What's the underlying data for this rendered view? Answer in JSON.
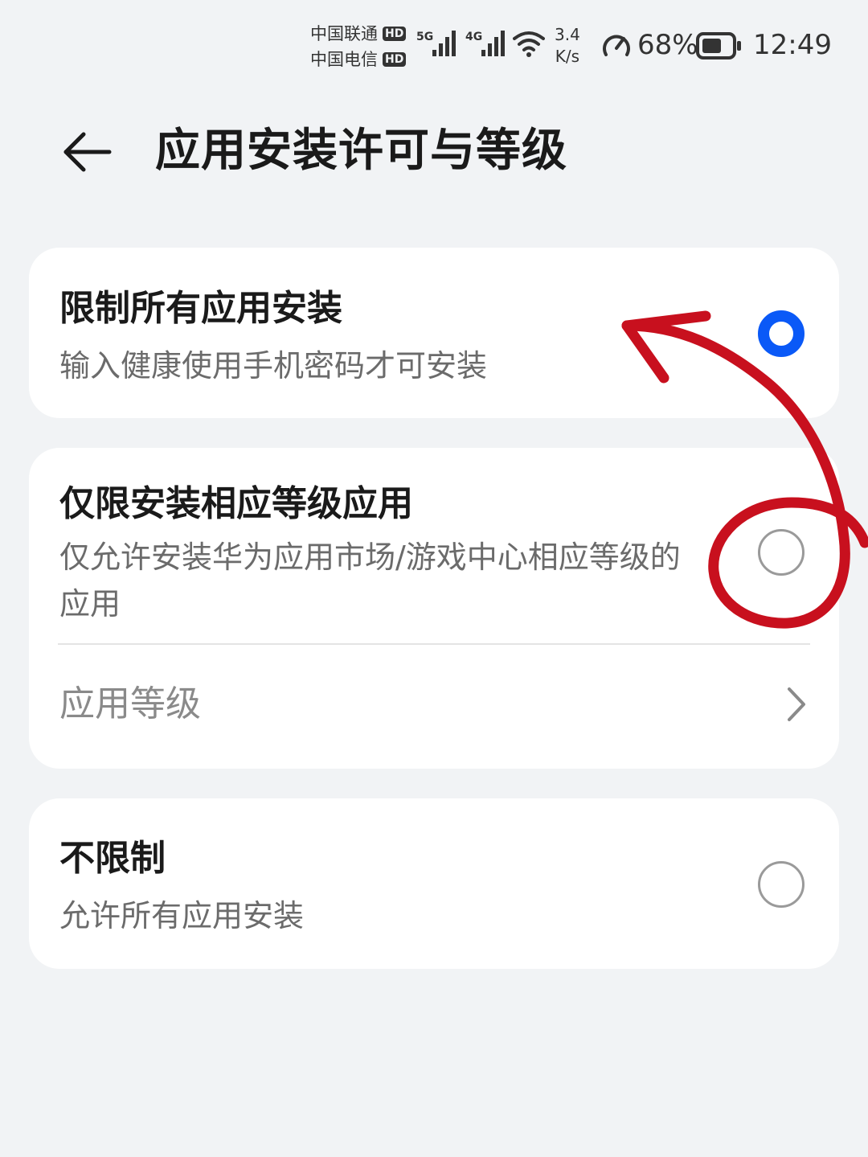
{
  "status_bar": {
    "carrier_1": "中国联通",
    "carrier_2": "中国电信",
    "hd_badge": "HD",
    "net_1": "5G",
    "net_2": "4G",
    "speed_value": "3.4",
    "speed_unit": "K/s",
    "battery_percent": "68%",
    "time": "12:49",
    "battery_level": 0.68,
    "icons": [
      "signal-5g-icon",
      "signal-4g-icon",
      "wifi-icon",
      "speed-gauge-icon",
      "battery-icon"
    ]
  },
  "header": {
    "title": "应用安装许可与等级",
    "back_icon": "back-arrow-icon"
  },
  "options": [
    {
      "title": "限制所有应用安装",
      "description": "输入健康使用手机密码才可安装",
      "selected": true
    },
    {
      "title": "仅限安装相应等级应用",
      "description": "仅允许安装华为应用市场/游戏中心相应等级的应用",
      "selected": false
    },
    {
      "title": "不限制",
      "description": "允许所有应用安装",
      "selected": false
    }
  ],
  "app_level": {
    "label": "应用等级",
    "icon": "chevron-right-icon"
  },
  "colors": {
    "background": "#f1f3f5",
    "card": "#ffffff",
    "accent": "#0a59f7",
    "annotation": "#c8101e"
  }
}
